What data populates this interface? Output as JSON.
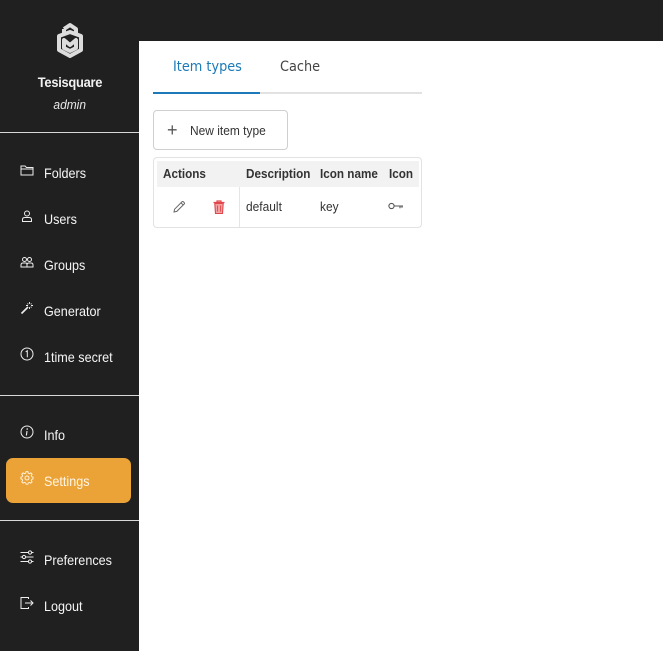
{
  "app": {
    "brand_name": "Tesisquare",
    "user_role": "admin",
    "logo_icon": "tesisquare-logo"
  },
  "sidebar": {
    "items": [
      {
        "label": "Folders",
        "icon": "folder-icon"
      },
      {
        "label": "Users",
        "icon": "user-icon"
      },
      {
        "label": "Groups",
        "icon": "group-icon"
      },
      {
        "label": "Generator",
        "icon": "magic-wand-icon"
      },
      {
        "label": "1time secret",
        "icon": "one-circle-icon"
      },
      {
        "label": "Info",
        "icon": "info-icon"
      },
      {
        "label": "Settings",
        "icon": "gear-icon",
        "active": true
      },
      {
        "label": "Preferences",
        "icon": "sliders-icon"
      },
      {
        "label": "Logout",
        "icon": "logout-icon"
      }
    ],
    "active_color": "#eba236"
  },
  "main": {
    "tabs": [
      {
        "label": "Item types",
        "active": true
      },
      {
        "label": "Cache",
        "active": false
      }
    ],
    "accent_color": "#1c7ab8",
    "new_button": {
      "label": "New item type",
      "icon": "plus-icon"
    },
    "table": {
      "columns": [
        "Actions",
        "Description",
        "Icon name",
        "Icon"
      ],
      "rows": [
        {
          "actions": [
            "edit-icon",
            "delete-icon"
          ],
          "description": "default",
          "icon_name": "key",
          "icon": "key-icon"
        }
      ]
    }
  }
}
